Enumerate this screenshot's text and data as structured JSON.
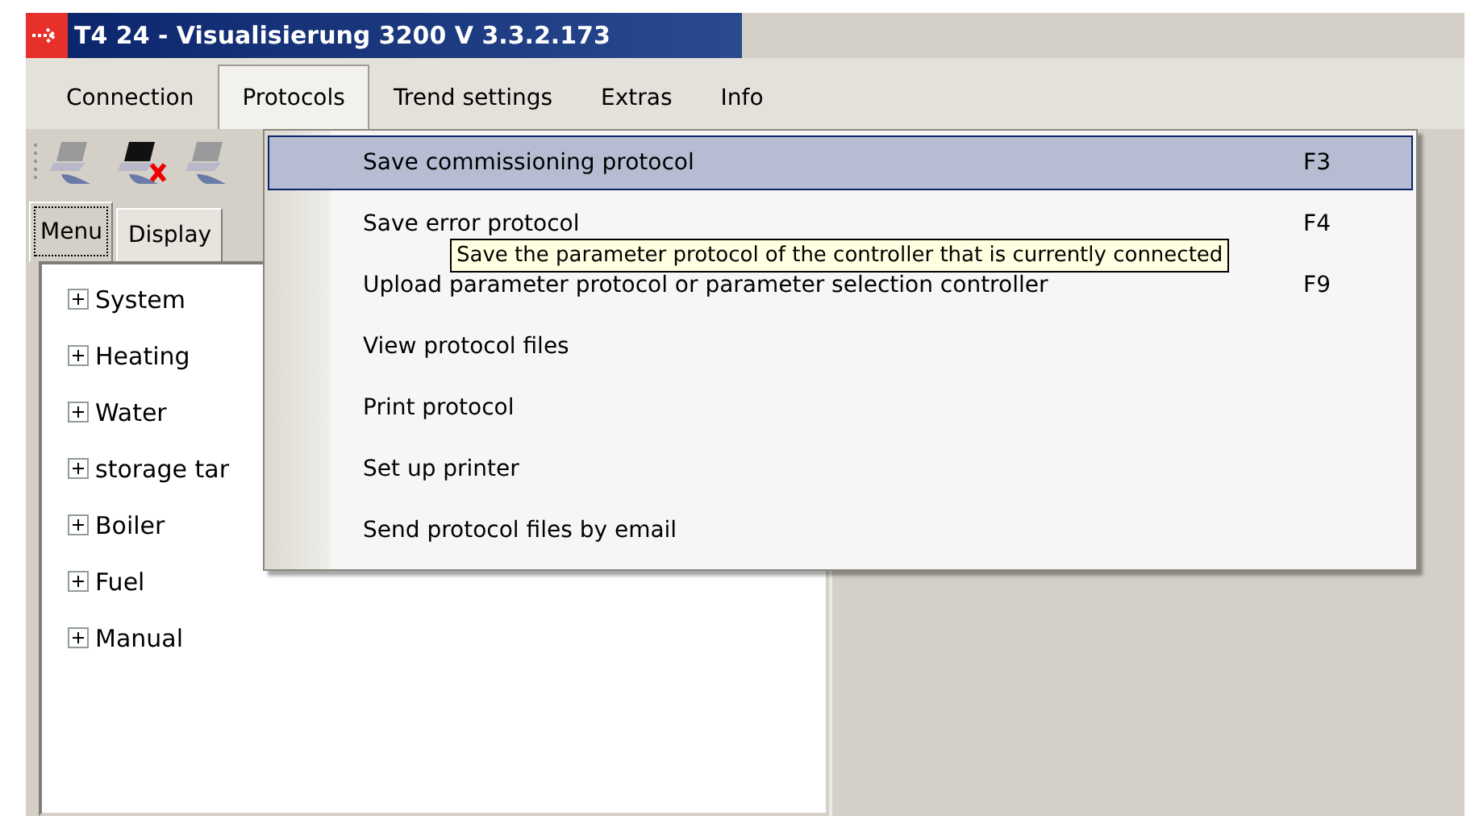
{
  "window": {
    "title": "T4 24 - Visualisierung 3200  V 3.3.2.173"
  },
  "menu_bar": [
    {
      "label": "Connection",
      "selected": false
    },
    {
      "label": "Protocols",
      "selected": true
    },
    {
      "label": "Trend settings",
      "selected": false
    },
    {
      "label": "Extras",
      "selected": false
    },
    {
      "label": "Info",
      "selected": false
    }
  ],
  "side_tabs": [
    {
      "label": "Menu",
      "selected": true
    },
    {
      "label": "Display",
      "selected": false
    }
  ],
  "tree": [
    {
      "label": "System",
      "expanded": false
    },
    {
      "label": "Heating",
      "expanded": false
    },
    {
      "label": "Water",
      "expanded": false
    },
    {
      "label": "storage tar",
      "expanded": false
    },
    {
      "label": "Boiler",
      "expanded": false
    },
    {
      "label": "Fuel",
      "expanded": false
    },
    {
      "label": "Manual",
      "expanded": false
    }
  ],
  "protocols_menu": [
    {
      "label": "Save commissioning protocol",
      "shortcut": "F3",
      "selected": true
    },
    {
      "label": "Save error protocol",
      "shortcut": "F4",
      "selected": false
    },
    {
      "label": "Upload parameter protocol or parameter selection controller",
      "shortcut": "F9",
      "selected": false
    },
    {
      "label": "View protocol files",
      "selected": false
    },
    {
      "label": "Print protocol",
      "selected": false
    },
    {
      "label": "Set up printer",
      "selected": false
    },
    {
      "label": "Send protocol files by email",
      "selected": false
    }
  ],
  "tooltip": "Save the parameter protocol of the controller that is currently connected"
}
